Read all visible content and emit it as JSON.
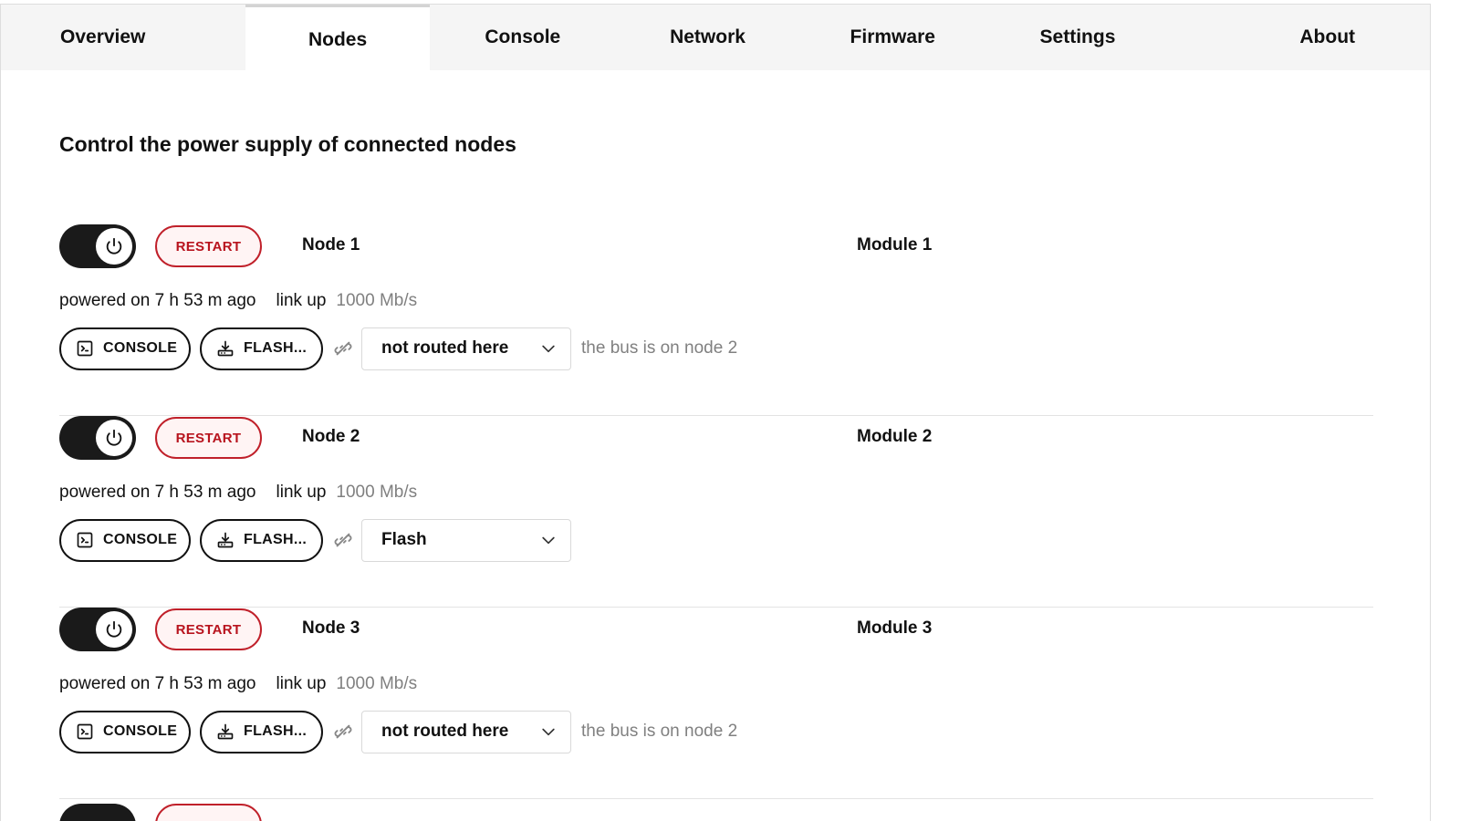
{
  "tabs": [
    {
      "label": "Overview"
    },
    {
      "label": "Nodes"
    },
    {
      "label": "Console"
    },
    {
      "label": "Network"
    },
    {
      "label": "Firmware"
    },
    {
      "label": "Settings"
    },
    {
      "label": "About"
    }
  ],
  "active_tab": "Nodes",
  "page_title": "Control the power supply of connected nodes",
  "labels": {
    "restart": "RESTART",
    "console": "CONSOLE",
    "flash": "FLASH...",
    "link_up": "link up"
  },
  "nodes": [
    {
      "name": "Node 1",
      "module": "Module 1",
      "power_on": true,
      "powered_text": "powered on 7 h 53 m ago",
      "speed": "1000 Mb/s",
      "route": "not routed here",
      "hint": "the bus is on node 2"
    },
    {
      "name": "Node 2",
      "module": "Module 2",
      "power_on": true,
      "powered_text": "powered on 7 h 53 m ago",
      "speed": "1000 Mb/s",
      "route": "Flash",
      "hint": ""
    },
    {
      "name": "Node 3",
      "module": "Module 3",
      "power_on": true,
      "powered_text": "powered on 7 h 53 m ago",
      "speed": "1000 Mb/s",
      "route": "not routed here",
      "hint": "the bus is on node 2"
    }
  ],
  "icons": {
    "power": "power-icon",
    "console": "terminal-icon",
    "flash": "download-icon",
    "link": "link-broken-icon",
    "dropdown": "chevron-down-icon"
  },
  "colors": {
    "accent_red": "#b8141e",
    "toggle_on": "#1a1a1a",
    "muted_text": "#808080"
  }
}
